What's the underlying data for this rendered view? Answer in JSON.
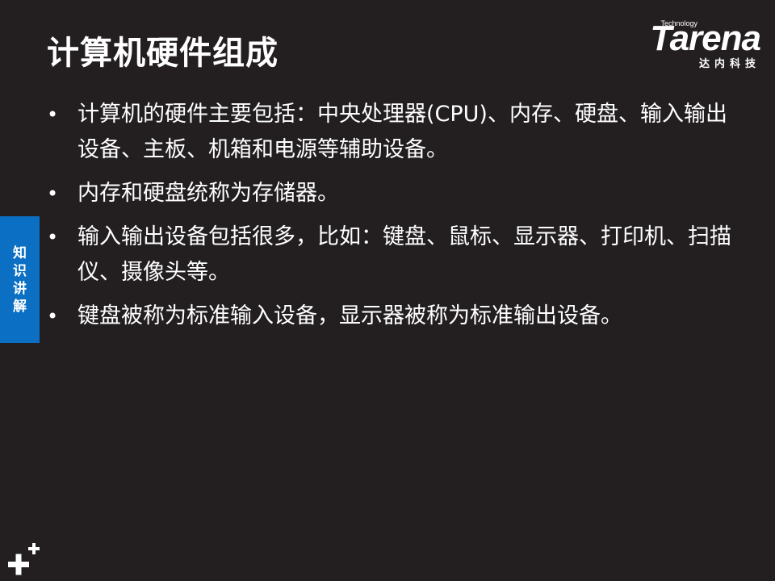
{
  "slide": {
    "title": "计算机硬件组成",
    "bullet_symbol": "•",
    "bullets": [
      "计算机的硬件主要包括：中央处理器(CPU)、内存、硬盘、输入输出设备、主板、机箱和电源等辅助设备。",
      "内存和硬盘统称为存储器。",
      "输入输出设备包括很多，比如：键盘、鼠标、显示器、打印机、扫描仪、摄像头等。",
      "键盘被称为标准输入设备，显示器被称为标准输出设备。"
    ]
  },
  "logo": {
    "small_text": "Technology",
    "word": "Tarena",
    "chinese": "达内科技"
  },
  "side_tab": {
    "chars": [
      "知",
      "识",
      "讲",
      "解"
    ]
  },
  "icons": {
    "corner": "plus-icon"
  },
  "colors": {
    "background": "#231f20",
    "text": "#ffffff",
    "tab": "#0b6fc4"
  }
}
